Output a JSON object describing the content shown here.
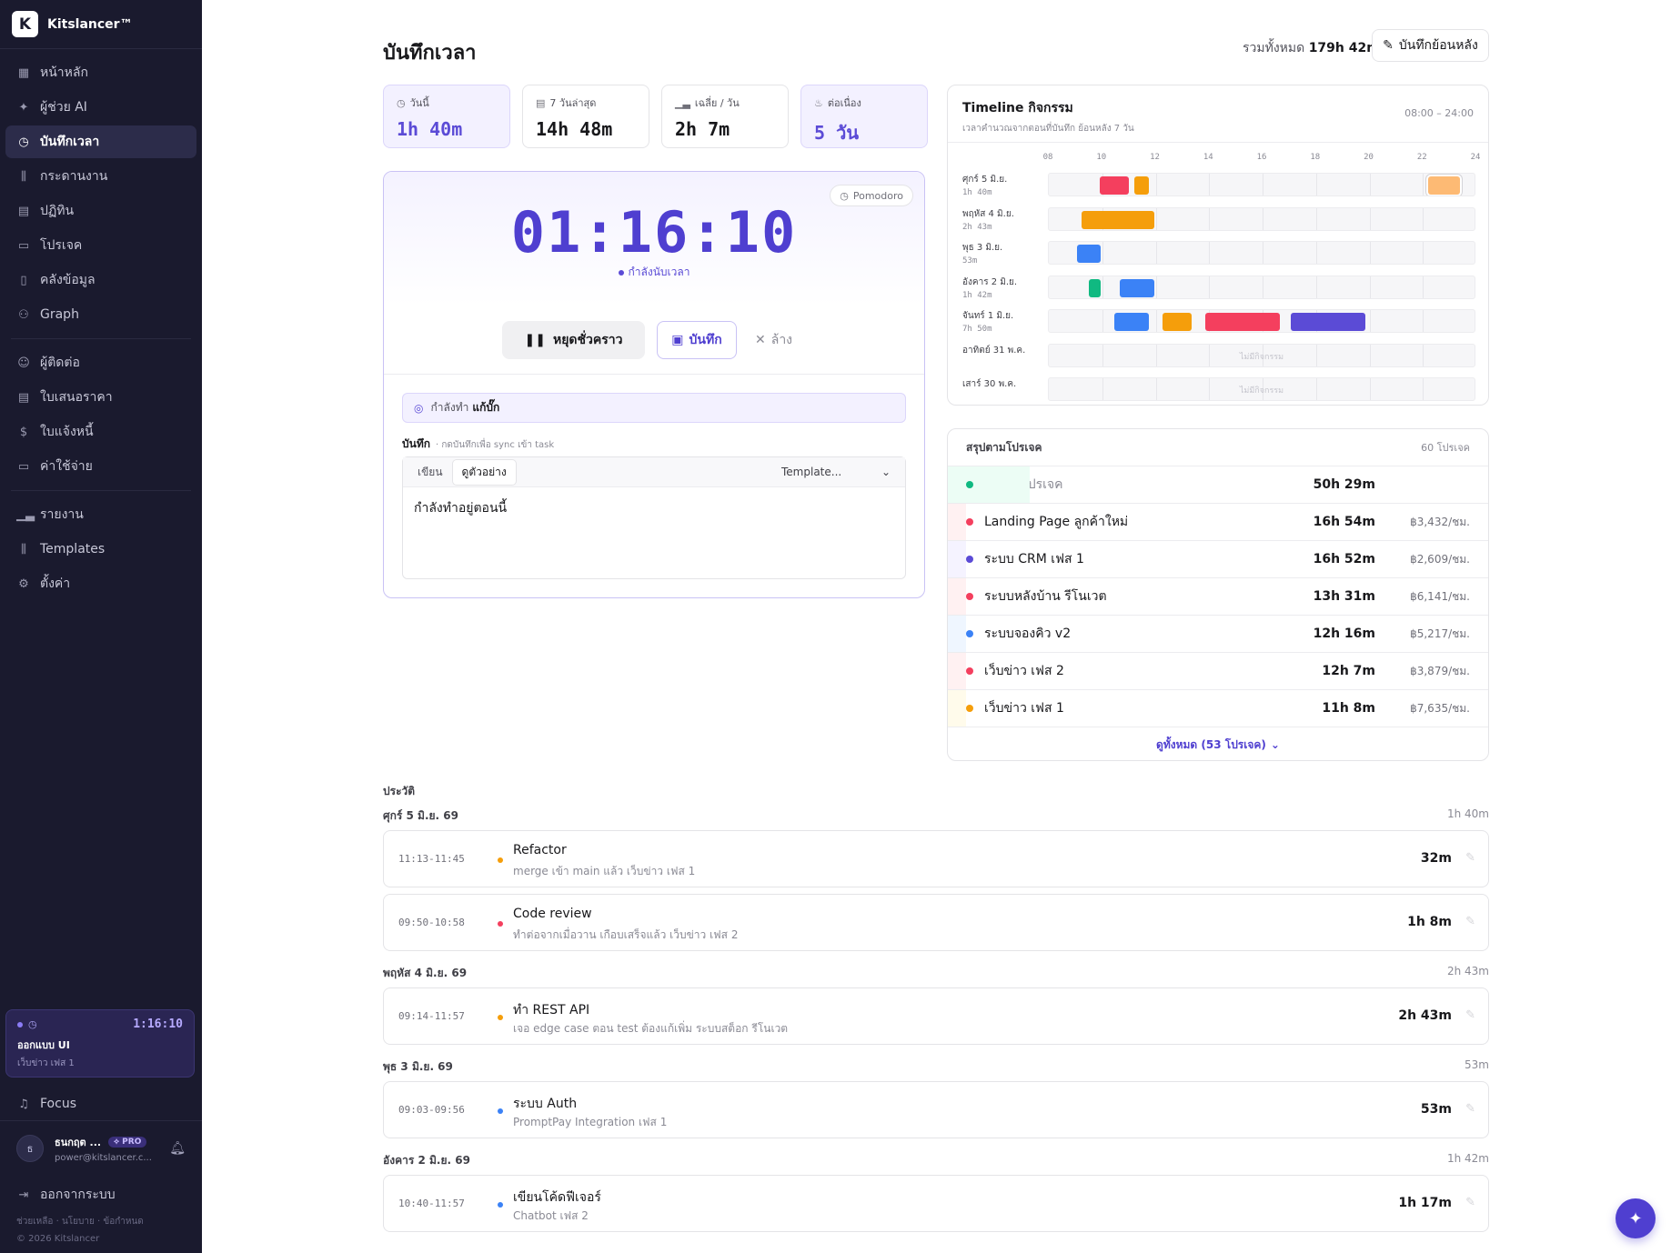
{
  "brand": {
    "name": "Kitslancer™",
    "logo": "K"
  },
  "nav": {
    "items1": [
      {
        "label": "หน้าหลัก",
        "icon": "▦",
        "active": false
      },
      {
        "label": "ผู้ช่วย AI",
        "icon": "✦",
        "active": false
      },
      {
        "label": "บันทึกเวลา",
        "icon": "◷",
        "active": true
      },
      {
        "label": "กระดานงาน",
        "icon": "⫼",
        "active": false
      },
      {
        "label": "ปฏิทิน",
        "icon": "▤",
        "active": false
      },
      {
        "label": "โปรเจค",
        "icon": "▭",
        "active": false
      },
      {
        "label": "คลังข้อมูล",
        "icon": "▯",
        "active": false
      },
      {
        "label": "Graph",
        "icon": "⚇",
        "active": false
      }
    ],
    "items2": [
      {
        "label": "ผู้ติดต่อ",
        "icon": "☺",
        "active": false
      },
      {
        "label": "ใบเสนอราคา",
        "icon": "▤",
        "active": false
      },
      {
        "label": "ใบแจ้งหนี้",
        "icon": "$",
        "active": false
      },
      {
        "label": "ค่าใช้จ่าย",
        "icon": "▭",
        "active": false
      }
    ],
    "items3": [
      {
        "label": "รายงาน",
        "icon": "▁▃",
        "active": false
      },
      {
        "label": "Templates",
        "icon": "⫼",
        "active": false
      },
      {
        "label": "ตั้งค่า",
        "icon": "⚙",
        "active": false
      }
    ]
  },
  "mini_timer": {
    "time": "1:16:10",
    "task": "ออกแบบ UI",
    "project": "เว็บข่าว เฟส 1"
  },
  "focus_label": "Focus",
  "user": {
    "initial": "ธ",
    "name": "ธนกฤต ...",
    "badge": "PRO",
    "email": "power@kitslancer.c..."
  },
  "logout_label": "ออกจากระบบ",
  "footer": {
    "links": "ช่วยเหลือ · นโยบาย · ข้อกำหนด",
    "copyright": "© 2026 Kitslancer"
  },
  "page": {
    "title": "บันทึกเวลา",
    "total_label": "รวมทั้งหมด",
    "total_value": "179h 42m",
    "backfill_label": "บันทึกย้อนหลัง"
  },
  "stats": [
    {
      "label": "วันนี้",
      "value": "1h 40m",
      "icon": "◷",
      "highlight": true
    },
    {
      "label": "7 วันล่าสุด",
      "value": "14h 48m",
      "icon": "▤",
      "highlight": false
    },
    {
      "label": "เฉลี่ย / วัน",
      "value": "2h 7m",
      "icon": "▁▃",
      "highlight": false
    },
    {
      "label": "ต่อเนื่อง",
      "value": "5 วัน",
      "icon": "♨",
      "highlight": true
    }
  ],
  "timer": {
    "pomodoro": "Pomodoro",
    "time": "01:16:10",
    "status": "กำลังนับเวลา",
    "pause_label": "หยุดชั่วคราว",
    "save_label": "บันทึก",
    "clear_label": "ล้าง",
    "doing_prefix": "กำลังทำ",
    "doing_task": "แก้บั๊ก",
    "note_label": "บันทึก",
    "note_hint": "· กดบันทึกเพื่อ sync เข้า task",
    "tab_write": "เขียน",
    "tab_preview": "ดูตัวอย่าง",
    "template_label": "Template...",
    "note_text": "กำลังทำอยู่ตอนนี้"
  },
  "timeline": {
    "title": "Timeline กิจกรรม",
    "subtitle": "เวลาคำนวณจากตอนที่บันทึก ย้อนหลัง 7 วัน",
    "range": "08:00 – 24:00",
    "ticks": [
      "08",
      "10",
      "12",
      "14",
      "16",
      "18",
      "20",
      "22",
      "24"
    ],
    "empty_text": "ไม่มีกิจกรรม",
    "days": [
      {
        "label": "ศุกร์ 5 มิ.ย.",
        "total": "1h 40m",
        "bars": [
          {
            "start": 9.9,
            "end": 11.0,
            "color": "#f43f5e"
          },
          {
            "start": 11.2,
            "end": 11.75,
            "color": "#f59e0b"
          },
          {
            "start": 22.2,
            "end": 23.4,
            "color": "#fdba74",
            "outline": true
          }
        ]
      },
      {
        "label": "พฤหัส 4 มิ.ย.",
        "total": "2h 43m",
        "bars": [
          {
            "start": 9.23,
            "end": 11.95,
            "color": "#f59e0b"
          }
        ]
      },
      {
        "label": "พุธ 3 มิ.ย.",
        "total": "53m",
        "bars": [
          {
            "start": 9.05,
            "end": 9.93,
            "color": "#3b82f6"
          }
        ]
      },
      {
        "label": "อังคาร 2 มิ.ย.",
        "total": "1h 42m",
        "bars": [
          {
            "start": 9.5,
            "end": 9.95,
            "color": "#10b981"
          },
          {
            "start": 10.67,
            "end": 11.95,
            "color": "#3b82f6"
          }
        ]
      },
      {
        "label": "จันทร์ 1 มิ.ย.",
        "total": "7h 50m",
        "bars": [
          {
            "start": 10.45,
            "end": 11.75,
            "color": "#3b82f6"
          },
          {
            "start": 12.25,
            "end": 13.35,
            "color": "#f59e0b"
          },
          {
            "start": 13.85,
            "end": 16.65,
            "color": "#f43f5e"
          },
          {
            "start": 17.05,
            "end": 19.85,
            "color": "#5b4bd6"
          }
        ]
      },
      {
        "label": "อาทิตย์ 31 พ.ค.",
        "total": "",
        "bars": []
      },
      {
        "label": "เสาร์ 30 พ.ค.",
        "total": "",
        "bars": []
      }
    ]
  },
  "projects": {
    "title": "สรุปตามโปรเจค",
    "count": "60 โปรเจค",
    "more_label": "ดูทั้งหมด (53 โปรเจค)",
    "rows": [
      {
        "name": "ไม่ระบุโปรเจค",
        "duration": "50h 29m",
        "rate": "",
        "color": "#10b981",
        "muted": true,
        "accent": "#ecfdf5"
      },
      {
        "name": "Landing Page ลูกค้าใหม่",
        "duration": "16h 54m",
        "rate": "฿3,432/ชม.",
        "color": "#f43f5e",
        "muted": false,
        "accent": "#fff1f2"
      },
      {
        "name": "ระบบ CRM เฟส 1",
        "duration": "16h 52m",
        "rate": "฿2,609/ชม.",
        "color": "#5b4bd6",
        "muted": false,
        "accent": "#f5f3ff"
      },
      {
        "name": "ระบบหลังบ้าน รีโนเวต",
        "duration": "13h 31m",
        "rate": "฿6,141/ชม.",
        "color": "#f43f5e",
        "muted": false,
        "accent": "#fff1f2"
      },
      {
        "name": "ระบบจองคิว v2",
        "duration": "12h 16m",
        "rate": "฿5,217/ชม.",
        "color": "#3b82f6",
        "muted": false,
        "accent": "#eff6ff"
      },
      {
        "name": "เว็บข่าว เฟส 2",
        "duration": "12h 7m",
        "rate": "฿3,879/ชม.",
        "color": "#f43f5e",
        "muted": false,
        "accent": "#fff1f2"
      },
      {
        "name": "เว็บข่าว เฟส 1",
        "duration": "11h 8m",
        "rate": "฿7,635/ชม.",
        "color": "#f59e0b",
        "muted": false,
        "accent": "#fffbeb"
      }
    ]
  },
  "history": {
    "title": "ประวัติ",
    "days": [
      {
        "date": "ศุกร์ 5 มิ.ย. 69",
        "total": "1h 40m",
        "entries": [
          {
            "time": "11:13-11:45",
            "title": "Refactor",
            "meta": "merge เข้า main แล้ว   เว็บข่าว เฟส 1",
            "duration": "32m",
            "color": "#f59e0b"
          },
          {
            "time": "09:50-10:58",
            "title": "Code review",
            "meta": "ทำต่อจากเมื่อวาน เกือบเสร็จแล้ว   เว็บข่าว เฟส 2",
            "duration": "1h 8m",
            "color": "#f43f5e"
          }
        ]
      },
      {
        "date": "พฤหัส 4 มิ.ย. 69",
        "total": "2h 43m",
        "entries": [
          {
            "time": "09:14-11:57",
            "title": "ทำ REST API",
            "meta": "เจอ edge case ตอน test ต้องแก้เพิ่ม   ระบบสต็อก รีโนเวต",
            "duration": "2h 43m",
            "color": "#f59e0b"
          }
        ]
      },
      {
        "date": "พุธ 3 มิ.ย. 69",
        "total": "53m",
        "entries": [
          {
            "time": "09:03-09:56",
            "title": "ระบบ Auth",
            "meta": "PromptPay Integration เฟส 1",
            "duration": "53m",
            "color": "#3b82f6"
          }
        ]
      },
      {
        "date": "อังคาร 2 มิ.ย. 69",
        "total": "1h 42m",
        "entries": [
          {
            "time": "10:40-11:57",
            "title": "เขียนโค้ดฟีเจอร์",
            "meta": "Chatbot เฟส 2",
            "duration": "1h 17m",
            "color": "#3b82f6"
          }
        ]
      }
    ]
  }
}
